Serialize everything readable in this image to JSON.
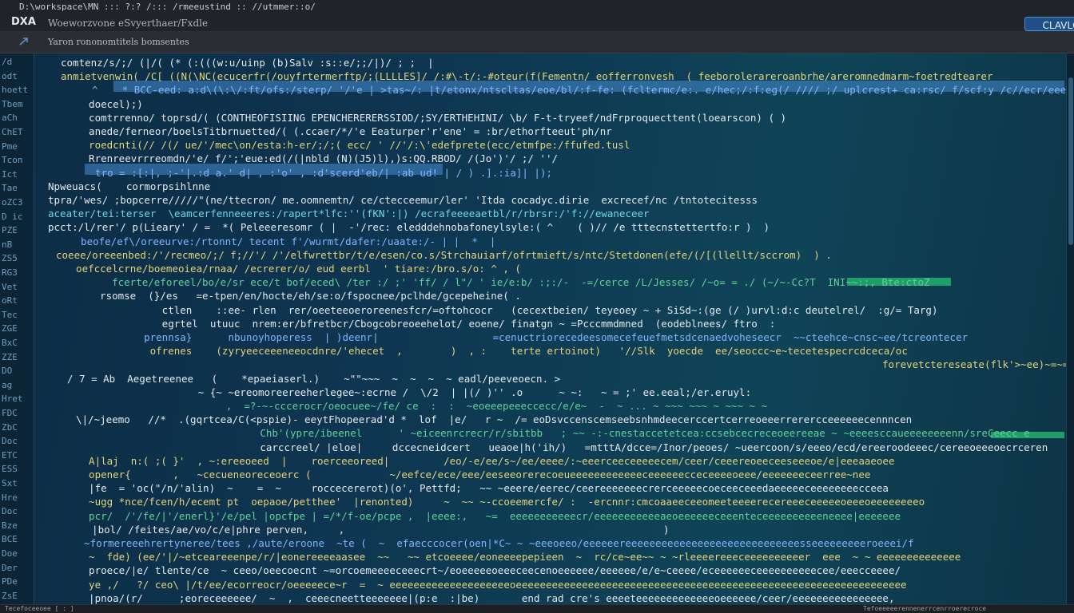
{
  "window": {
    "title_path": "D:\\workspace\\MN ::: ?:? /::: /rmeeustind :: //utmmer::o/"
  },
  "app": {
    "logo": "DXA",
    "subtitle": "Woeworzvone  eSvyerthaer/Fxdle",
    "claude_button": "CLAVLG"
  },
  "subbar": {
    "label": "Yaron rononomtitels bomsentes"
  },
  "gutter": {
    "labels": [
      "/d",
      "odt",
      "hoett",
      "Tbem",
      "aCh",
      "ChET",
      "Pme",
      "Tcon",
      "Ict",
      "Tae",
      "oZC3",
      "D ic",
      "PZE",
      "nB",
      "ZS5",
      "RG3",
      "Vet",
      "oRt",
      "Tec",
      "ZGE",
      "BxC",
      "ZZE",
      "DO",
      "ag",
      "Hret",
      "FDC",
      "ZbC",
      "Doc",
      "ETC",
      "ESS",
      "Sxt",
      "Hre",
      "Doc",
      "Bze",
      "BCE",
      "Doe",
      "Der",
      "PDe",
      "ZsE"
    ]
  },
  "code": {
    "lines": [
      {
        "text": "comtenz/s/;/ (|/( (* (:(((w:u/uinp (b)Salv :s::e/;;/|)/ ; ;  |",
        "color": "white"
      },
      {
        "text": "anmietvenwin( /C[ ((N(\\NC(ecucerfr(/ouyfrtermerftp/;(LLLLES]/ /:#\\-t/:-#oteur(f(Fementn/ eofferronvesh  ( feeborolerareroanbrhe/areromnedmarm~foetredtearer",
        "color": "yellow"
      },
      {
        "text": "  ^    * BCC-eed: a:d\\(\\:\\/:ft/ofs:/sterp/ '/'e | >tas~/: |t/etonx/ntscltas/eoe/bl/:f-fe: (fcltermc/e:. e/hec;/:f:eg(/ //// ;/ uplcrest+ ca:rsc/ f/scf:y /c//ecr/eeeet",
        "color": "blue"
      },
      {
        "text": "  doecel);)",
        "color": "white"
      },
      {
        "text": "  comtrrenno/ toprsd/( (CONTHEOFISIING EPENCHERERERSSIOD/;SY/ERTHEHINI/ \\b/ F-t-tryeef/ndFrproquecttent(loearscon) ( )",
        "color": "white"
      },
      {
        "text": "  anede/ferneor/boelsTitbrnuetted/( (.ccaer/*/'e Eeaturper'r'ene' = :br/ethorfteeut'ph/nr",
        "color": "white"
      },
      {
        "text": "  roedcnti(// /(/ ue/'/mec\\on/esta:h-er/;/;( ecc/ ' //'/:\\'edefprete(ecc/etmfpe:/ffufed.tusl",
        "color": "yellow"
      },
      {
        "text": "  Rrenreevrrreomdn/'e/ f/';'eue:ed(/(|nbld (N)(J5)l),)s:QQ.RBOD/ /(Jo')'/ ;/ ''/",
        "color": "white"
      },
      {
        "text": "  tro = :[:|, ;-'|.:d a.' d| , :'o' , :d'scerd'eb/| :ab ud! | / ) .].:ia]| |);",
        "color": "blue"
      },
      {
        "text": "Npweuacs(    cormorpsihlnne",
        "color": "white"
      },
      {
        "text": "tpra/'wes/ ;bopcerre/////\"(ne/ttecron/ me.oomnemtn/ ce/ctecceemur/ler' 'Itda cocadyc.dirie  excrecef/nc /tntotecitesss",
        "color": "white"
      },
      {
        "text": "aceater/tei:terser  \\eamcerfenneeeres:/rapert*lfc:''(fKN':|) /ecrafeeeeaetbl/r/rbrsr:/'f://ewaneceer",
        "color": "cyan"
      },
      {
        "text": "pcct:/l/rer'/ p(Lieary' / =  *( Peleeeresomr ( |  -'/rec: eledddehnobafoneylsyle:( ^    ( )// /e tttecnstettertfo:r )  )",
        "color": "white"
      },
      {
        "text": "  beofe/ef\\/oreeurve:/rtonnt/ tecent f'/wurmt/dafer:/uaate:/- | |  *  |",
        "color": "blue"
      },
      {
        "text": "coeee/oreeenbed:/'/recmeo/;/ f;//'/ /'/elfwrettbr/t/e/esen/co.s/Strchauiarf/ofrtmieft/s/ntc/Stetdonen(efe/(/[(llellt/sccrom)  ) .",
        "color": "yellow"
      },
      {
        "text": "  oefccelcrne/boemeoiea/rnaa/ /ecrerer/o/ eud eerbl  ' tiare:/bro.s/o: ^ , (",
        "color": "yellow"
      },
      {
        "text": "    fcerte/eforeel/bo/e/sr ece/t bof/eced\\ /ter :/ ;' 'ff/ / l\"/ ' ie/e:b/ :;:/-  -=/cerce /L/Jesses/ /~o= = ./ (~/~-Cc?T  INI~~:;, Bte:ctoZ",
        "color": "green"
      },
      {
        "text": "  rsomse  (}/es   =e-tpen/en/hocte/eh/se:o/fspocnee/pclhde/gcepeheine( .",
        "color": "white"
      },
      {
        "text": "       ctlen    ::ee- rlen  rer/oeeteeoeroreenesfcr/=oftohcocr   (cecextbeien/ teyeoey ~ + SiSd~:(ge (/ )urvl:d:c deutelrel/  :g/= Targ)",
        "color": "white"
      },
      {
        "text": "       egrtel  utuuc  nrem:er/bfretbcr/Cbogcobreoeehelot/ eoene/ finatgn ~ =Pcccmmdmned  (eodeblnees/ ftro  : ",
        "color": "white"
      },
      {
        "text": "    prennsa}      nbunoyhoperess  | )deenr|                   =cenuctriorecedeesomecefeuefmetsdcenaedvoheseecr  ~~cteehce~cnsc~ee/tcreontecer ",
        "color": "blue"
      },
      {
        "text": "     ofrenes    (zyryeeceeeneeocdnre/'ehecet  ,        )  , :    terte ertoinot)   '//Slk  yoecde  ee/seoccc~e~tecetespecrcdceca/oc",
        "color": "yellow"
      },
      {
        "text": "                                                           forevetctereseate(flk'>~ee)~=~=====*=\"",
        "color": "yellow"
      },
      {
        "text": "/ 7 = Ab  Aegetreenee   (    *epaeiaserl.)    ~\"\"~~~  ~  ~  ~  ~ eadl/peeveoecn. >",
        "color": "white"
      },
      {
        "text": "         ~ {~ ~ereomoreereeherlegee~:ecrne /  \\/2  | |(/ )'' .o      ~ ~:   ~ = ;' ee.eeal;/er.eruyl:",
        "color": "white"
      },
      {
        "text": "           ,  =?-~-cccerocr/oeocuee~/fe/ ce  :  :  ~eoeeepeeeccecc/e/e~  -  ~ ... ~ ~~~ ~~~ ~ ~~~ ~ ~",
        "color": "green"
      },
      {
        "text": "  \\|/~jeemo   //*  .(gqrtcea/C(<pspie)- eeytFhopeerad'd *  lof  |e/   r ~  /= eoDsvccenscemseebsnhmdeecerccertcerreoeeerrerercceeeeeecennncen",
        "color": "white"
      },
      {
        "text": "              Chb'(ypre/ibeenel      ' ~eiceenrcrecr/r/sbitbb   ; ~~ -:-cnestaccetetcea:ccsebcecreceoeereeae ~ ~eeeesccaueeeeeeeenn/sreCeecc e",
        "color": "green"
      },
      {
        "text": "              carccreel/ |eloe|     dccecneidcert   ueaoe|h('ih/)   =mtttA/dcce=/Inor/peoes/ ~ueercoon/s/eeeo/ecd/ereeroodeeec/cereeoeeeoecrceren",
        "color": "white"
      },
      {
        "text": "  A|laj  n:( ;( }'  , ~:ereeoeed  |    roerceeoreed|         /eo/-e/ee/s~/ee/eeee/:~eeerceeceeeeecem/ceer/ceeereoeeceeseeeoe/e|eeeaaeoee ",
        "color": "yellow"
      },
      {
        "text": "  opener{       ,   ~cecueneoreceoerc (             ~/eefce/ece/eee/eeseeorerecoeueeeeeeeeeeeeceeeeeecceceeeeoeee/eeeeeeeceerree~nee",
        "color": "yellow"
      },
      {
        "text": "  |fe  = 'oc(\"/n/'alin)  ~    =  ~     roccecererot)(o', Pettfd;   ~~ ~eeere/eerec/ceereeeeeeecrerceeeeecoeceeceeedaeeeeeceeeeeeeecceea",
        "color": "white"
      },
      {
        "text": "  ~ugg *nce/fcen/h/ecemt pt  oepaoe/petthee'  |renonted)     ~  ~~ ~-ccoeemercfe/ :  -ercnnr:cmcoaaeeceeomeeteeeerecereeeceeeeeoeeeoeeeeeeeeo",
        "color": "yellow"
      },
      {
        "text": "  pcr/  /'/fe/|'/enerl}'/e/pel |opcfpe | =/*/f-oe/pcpe ,  |eeee:,   ~=  eeeeeeeeeeecr/eeeeeeeeeeeaeoeeeeeeceeenteceeeeeeeeeeneeee|eeeeeee",
        "color": "green"
      },
      {
        "text": "  |bol/ /feites/ae/vo/c/e|phre perven,     ,                                                     )",
        "color": "white"
      },
      {
        "text": "  ~formereeehrertyneree/tees ,/aute/eroone  ~te (  ~  efaecccocer(oen|*C~ ~ ~eeeoeeo/eeeeeereeeeeeeeeeeeeeeeeeeeeeeeeeeeesseeeeeeeeeroeeei/f",
        "color": "blue"
      },
      {
        "text": "  ~  fde) (ee/'|/~etceareeenpe/r/|eonereeeeaasee  ~~   ~~ etcoeeee/eoneeeepepieen  ~  rc/ce~ee~~ ~ ~rleeeereeeceeeeeeeeeer  eee  ~ ~ eeeeeeeeeeeeee",
        "color": "yellow"
      },
      {
        "text": "  proece/|e/ tlente/ce  ~ ceeo/oeecoecnt ~=orcoemeeeeceeecrt~/eoeeeeeoeeeceecenoeeeeee/eeeeee/e/e~ceeee/eceeeeeeceeeeeeeeeecee/eeecceeee/",
        "color": "white"
      },
      {
        "text": "  ye ,/   ?/ ceo\\ |/t/ee/ecorreocr/oeeeeece~r  =  ~ eeeeeeeeeeeeeeeeeeeeoeeeeeeeeeeeeeeeeeeeeeeeeeeeeeeeeeeeeeeeeeeeeeeeeeeeeeeeeeeeeeeeee",
        "color": "yellow"
      },
      {
        "text": "  |pnoa/(r/      ;eoreceeeeee/  ~  ,  ceeecneetteeeeeee|(p:e  :|be)       end rad cre's eeeeteeeeeeeeeeeeeoeeeeee/ceer/eeeeeeeeeeeeeeee,",
        "color": "white"
      }
    ]
  },
  "status": {
    "left": "Tecefoceeoee   [ :  ]",
    "right": "Tefoeeeeerennenerrcenrroerecroce"
  },
  "colors": {
    "title_bg": "#202327",
    "editor_bg": "#0e3551",
    "accent_blue": "#1f4f86",
    "token_yellow": "#e4d37a",
    "token_green": "#5fd39a",
    "token_blue": "#7fb6ff",
    "token_white": "#e5e9ee"
  },
  "icons": {
    "subbar": "arrow-icon"
  }
}
